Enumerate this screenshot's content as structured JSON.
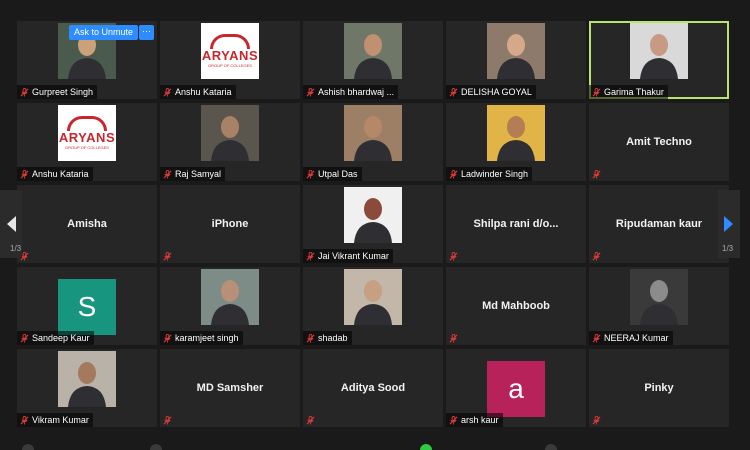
{
  "ask_to_unmute": "Ask to Unmute",
  "more_button": "···",
  "pager_text": "1/3",
  "colors": {
    "accent": "#2d8cff",
    "active_border": "#b9e36a",
    "mute": "#e03b3b"
  },
  "tiles": [
    {
      "name": "Gurpreet Singh",
      "kind": "photo",
      "bg": "#4a5b4e",
      "skin": "#c9a27b"
    },
    {
      "name": "Anshu Kataria",
      "kind": "logo",
      "brand": "ARYANS",
      "sub": "GROUP OF COLLEGES"
    },
    {
      "name": "Ashish bhardwaj ...",
      "kind": "photo",
      "bg": "#6f7768",
      "skin": "#c09070"
    },
    {
      "name": "DELISHA GOYAL",
      "kind": "photo",
      "bg": "#8d7a6b",
      "skin": "#d4a889"
    },
    {
      "name": "Garima Thakur",
      "kind": "photo",
      "bg": "#d9d9d9",
      "skin": "#c79a84",
      "active": true
    },
    {
      "name": "Anshu Kataria",
      "kind": "logo",
      "brand": "ARYANS",
      "sub": "GROUP OF COLLEGES"
    },
    {
      "name": "Raj Samyal",
      "kind": "photo",
      "bg": "#5a564e",
      "skin": "#a88266"
    },
    {
      "name": "Utpal Das",
      "kind": "photo",
      "bg": "#9c7f64",
      "skin": "#b58967"
    },
    {
      "name": "Ladwinder Singh",
      "kind": "photo",
      "bg": "#e0b446",
      "skin": "#b57d54"
    },
    {
      "name": "Amit Techno",
      "kind": "name"
    },
    {
      "name": "Amisha",
      "kind": "name"
    },
    {
      "name": "iPhone",
      "kind": "name"
    },
    {
      "name": "Jai Vikrant Kumar",
      "kind": "photo",
      "bg": "#f0f0f0",
      "skin": "#8a4b3a"
    },
    {
      "name": "Shilpa  rani d/o...",
      "kind": "name"
    },
    {
      "name": "Ripudaman kaur",
      "kind": "name"
    },
    {
      "name": "Sandeep Kaur",
      "kind": "avatar",
      "letter": "S",
      "color": "#17957e"
    },
    {
      "name": "karamjeet singh",
      "kind": "photo",
      "bg": "#7d8c86",
      "skin": "#b89077"
    },
    {
      "name": "shadab",
      "kind": "photo",
      "bg": "#c2b7a9",
      "skin": "#c7a082"
    },
    {
      "name": "Md Mahboob",
      "kind": "name"
    },
    {
      "name": "NEERAJ Kumar",
      "kind": "photo",
      "bg": "#3a3a3a",
      "skin": "#8c8c8c"
    },
    {
      "name": "Vikram Kumar",
      "kind": "photo",
      "bg": "#b8b2a9",
      "skin": "#a47a5e"
    },
    {
      "name": "MD Samsher",
      "kind": "name"
    },
    {
      "name": "Aditya Sood",
      "kind": "name"
    },
    {
      "name": "arsh kaur",
      "kind": "avatar",
      "letter": "a",
      "color": "#b8225a"
    },
    {
      "name": "Pinky",
      "kind": "name"
    }
  ]
}
